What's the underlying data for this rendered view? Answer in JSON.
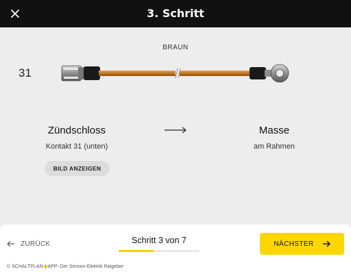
{
  "header": {
    "title": "3. Schritt",
    "close_icon": "close-icon"
  },
  "wire": {
    "color_label": "BRAUN",
    "pin_number": "31",
    "wire_color_hex": "#c97a22"
  },
  "connection": {
    "from": {
      "name": "Zündschloss",
      "detail": "Kontakt 31 (unten)"
    },
    "to": {
      "name": "Masse",
      "detail": "am Rahmen"
    },
    "arrow_icon": "long-arrow-right-icon"
  },
  "show_image_button": "BILD ANZEIGEN",
  "navigation": {
    "back_label": "ZURÜCK",
    "back_icon": "arrow-left-icon",
    "next_label": "NÄCHSTER",
    "next_icon": "arrow-right-icon",
    "progress_label": "Schritt 3 von 7",
    "progress_fraction": 0.43
  },
  "footer": {
    "app_name_part1": "SCHALTPLAN",
    "app_name_part2": "APP",
    "tagline": " - Der Simson-Elektrik Ratgeber",
    "bolt_icon": "lightning-bolt-icon"
  },
  "colors": {
    "accent": "#ffd600",
    "header_bg": "#111111",
    "page_bg": "#ededed"
  }
}
